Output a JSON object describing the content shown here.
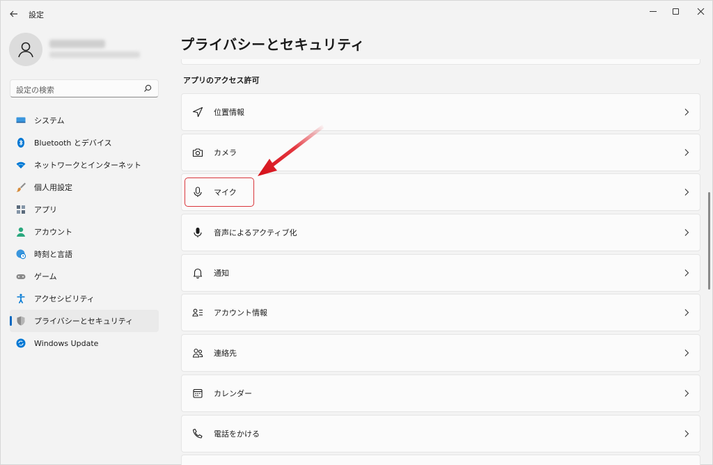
{
  "window": {
    "title": "設定",
    "back_icon": "back-arrow-icon",
    "controls": [
      "minimize-icon",
      "maximize-icon",
      "close-icon"
    ]
  },
  "sidebar": {
    "search_placeholder": "設定の検索",
    "items": [
      {
        "label": "システム",
        "icon": "system-icon",
        "color": "#0078d4",
        "active": false
      },
      {
        "label": "Bluetooth とデバイス",
        "icon": "bluetooth-icon",
        "color": "#0078d4",
        "active": false
      },
      {
        "label": "ネットワークとインターネット",
        "icon": "wifi-icon",
        "color": "#0078d4",
        "active": false
      },
      {
        "label": "個人用設定",
        "icon": "brush-icon",
        "color": "#c67b2e",
        "active": false
      },
      {
        "label": "アプリ",
        "icon": "apps-icon",
        "color": "#5b6b7c",
        "active": false
      },
      {
        "label": "アカウント",
        "icon": "account-icon",
        "color": "#2aa87e",
        "active": false
      },
      {
        "label": "時刻と言語",
        "icon": "globe-clock-icon",
        "color": "#0078d4",
        "active": false
      },
      {
        "label": "ゲーム",
        "icon": "gamepad-icon",
        "color": "#7a7a7a",
        "active": false
      },
      {
        "label": "アクセシビリティ",
        "icon": "accessibility-icon",
        "color": "#0078d4",
        "active": false
      },
      {
        "label": "プライバシーとセキュリティ",
        "icon": "shield-icon",
        "color": "#7a7a7a",
        "active": true
      },
      {
        "label": "Windows Update",
        "icon": "update-icon",
        "color": "#0078d4",
        "active": false
      }
    ]
  },
  "main": {
    "title": "プライバシーとセキュリティ",
    "section_title": "アプリのアクセス許可",
    "items": [
      {
        "label": "位置情報",
        "icon": "location-icon"
      },
      {
        "label": "カメラ",
        "icon": "camera-icon"
      },
      {
        "label": "マイク",
        "icon": "microphone-icon"
      },
      {
        "label": "音声によるアクティブ化",
        "icon": "voice-activation-icon"
      },
      {
        "label": "通知",
        "icon": "bell-icon"
      },
      {
        "label": "アカウント情報",
        "icon": "account-info-icon"
      },
      {
        "label": "連絡先",
        "icon": "contacts-icon"
      },
      {
        "label": "カレンダー",
        "icon": "calendar-icon"
      },
      {
        "label": "電話をかける",
        "icon": "phone-icon"
      }
    ]
  },
  "annotation": {
    "highlight_color": "#d9353a",
    "arrow_color": "#e0141e"
  }
}
